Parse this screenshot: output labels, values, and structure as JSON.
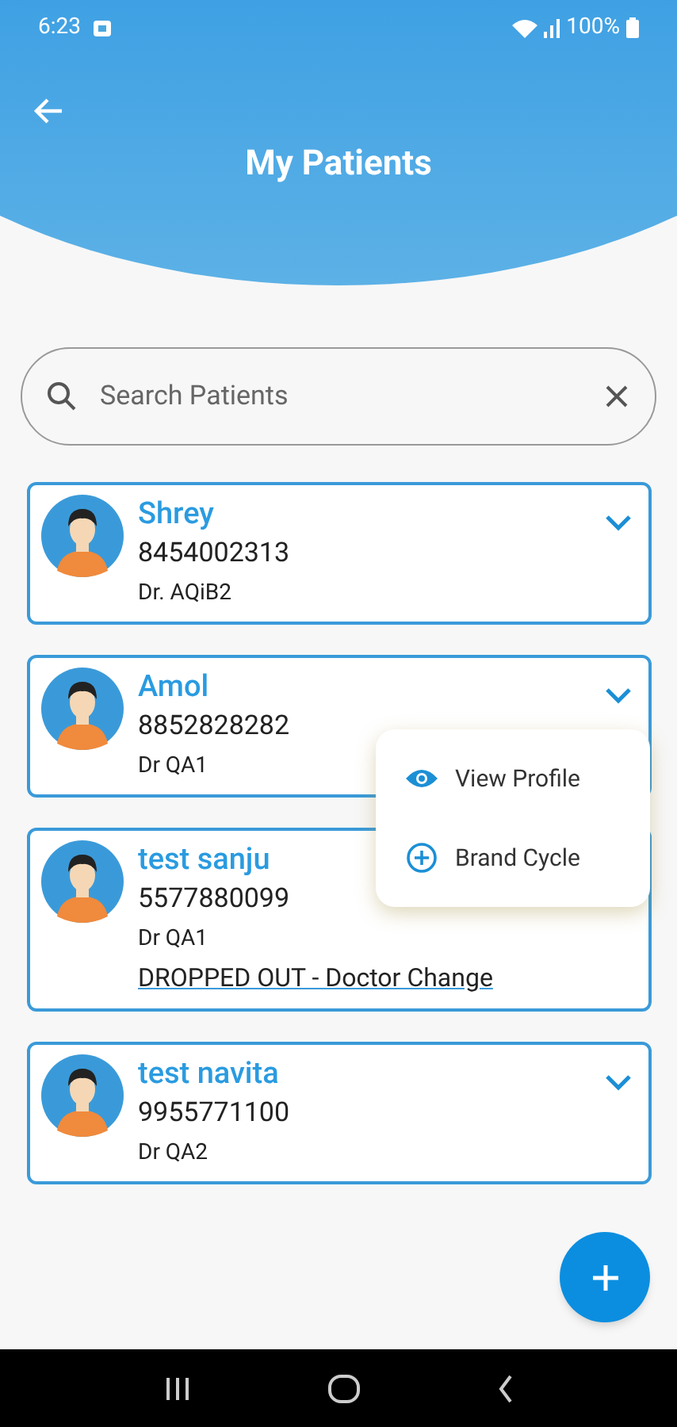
{
  "status_bar": {
    "time": "6:23",
    "battery": "100%"
  },
  "header": {
    "title": "My Patients"
  },
  "search": {
    "placeholder": "Search Patients"
  },
  "patients": [
    {
      "name": "Shrey",
      "phone": "8454002313",
      "doctor": "Dr. AQiB2"
    },
    {
      "name": "Amol",
      "phone": "8852828282",
      "doctor": "Dr QA1"
    },
    {
      "name": "test sanju",
      "phone": "5577880099",
      "doctor": "Dr QA1",
      "status": "DROPPED OUT - Doctor Change"
    },
    {
      "name": "test navita",
      "phone": "9955771100",
      "doctor": "Dr QA2"
    }
  ],
  "menu": {
    "items": [
      {
        "kind": "view",
        "label": "View Profile"
      },
      {
        "kind": "add",
        "label": "Brand Cycle"
      }
    ]
  }
}
